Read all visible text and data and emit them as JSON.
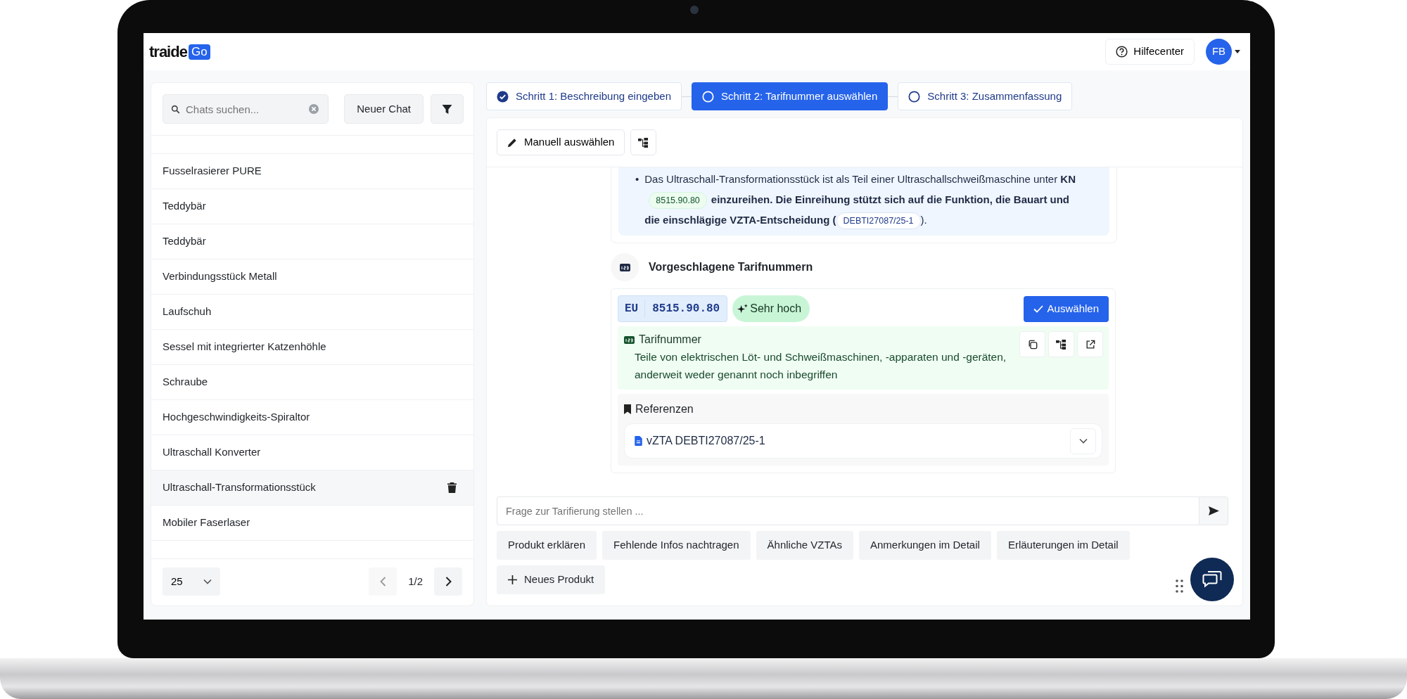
{
  "app": {
    "logo_text": "traide",
    "logo_badge": "Go"
  },
  "header": {
    "help_button": "Hilfecenter",
    "avatar": "FB"
  },
  "sidebar": {
    "search": {
      "placeholder": "Chats suchen..."
    },
    "new_chat_button": "Neuer Chat",
    "chats": [
      {
        "title": "Fusselrasierer PURE",
        "selected": false
      },
      {
        "title": "Teddybär",
        "selected": false
      },
      {
        "title": "Teddybär",
        "selected": false
      },
      {
        "title": "Verbindungsstück Metall",
        "selected": false
      },
      {
        "title": "Laufschuh",
        "selected": false
      },
      {
        "title": "Sessel mit integrierter Katzenhöhle",
        "selected": false
      },
      {
        "title": "Schraube",
        "selected": false
      },
      {
        "title": "Hochgeschwindigkeits-Spiraltor",
        "selected": false
      },
      {
        "title": "Ultraschall Konverter",
        "selected": false
      },
      {
        "title": "Ultraschall-Transformationsstück",
        "selected": true
      },
      {
        "title": "Mobiler Faserlaser",
        "selected": false
      }
    ],
    "page_size": "25",
    "page": "1/2"
  },
  "steps": [
    {
      "label": "Schritt 1: Beschreibung eingeben",
      "completed": true,
      "selected": false
    },
    {
      "label": "Schritt 2: Tarifnummer auswählen",
      "completed": false,
      "selected": true
    },
    {
      "label": "Schritt 3: Zusammenfassung",
      "completed": false,
      "selected": false
    }
  ],
  "toolbar": {
    "manual_button": "Manuell auswählen"
  },
  "message": {
    "bullet": "•",
    "segments": [
      {
        "kind": "text",
        "text": "Das Ultraschall-Transformationsstück ist als Teil einer Ultraschallschweißmaschine unter "
      },
      {
        "kind": "bold",
        "text": "KN"
      },
      {
        "kind": "tariff_chip",
        "text": "8515.90.80"
      },
      {
        "kind": "bold",
        "text": "einzureihen. Die Einreihung stützt sich auf die Funktion, die Bauart und die einschlägige VZTA-Entscheidung ("
      },
      {
        "kind": "reference_chip",
        "text": "DEBTI27087/25-1"
      },
      {
        "kind": "text",
        "text": ")."
      }
    ]
  },
  "suggestions": {
    "title": "Vorgeschlagene Tarifnummern",
    "results": [
      {
        "region": "EU",
        "code": "8515.90.80",
        "confidence": "Sehr hoch",
        "select_button": "Auswählen",
        "description_label": "Tarifnummer",
        "description": "Teile von elektrischen Löt- und Schweißmaschinen, -apparaten und -geräten, anderweit weder genannt noch inbegriffen",
        "references_label": "Referenzen",
        "references": [
          {
            "title": "vZTA DEBTI27087/25-1",
            "expanded": false
          }
        ]
      }
    ]
  },
  "chat_input": {
    "placeholder": "Frage zur Tarifierung stellen ..."
  },
  "quick_actions": [
    "Produkt erklären",
    "Fehlende Infos nachtragen",
    "Ähnliche VZTAs",
    "Anmerkungen im Detail",
    "Erläuterungen im Detail"
  ],
  "new_product_button": "Neues Produkt"
}
